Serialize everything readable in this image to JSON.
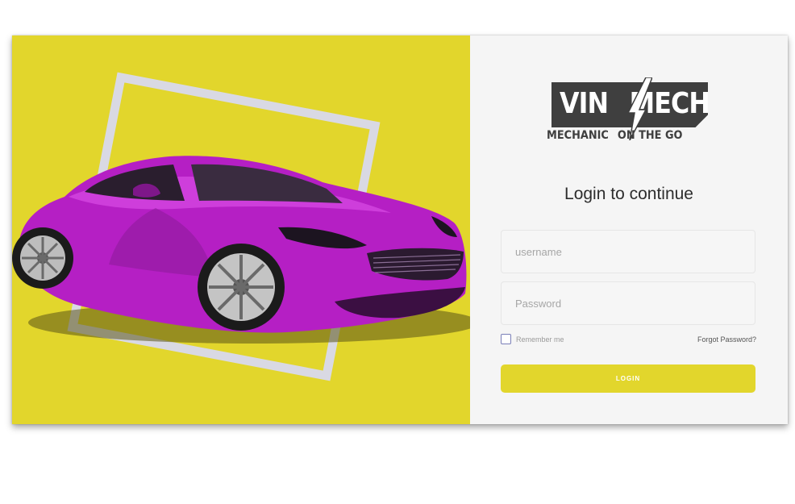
{
  "brand": {
    "name_left": "VIN",
    "name_right": "MECH",
    "tagline_left": "MECHANIC",
    "tagline_right": "ON THE GO"
  },
  "hero": {
    "background_color": "#e2d62c",
    "car_color": "#b51fc4",
    "frame_color": "#d9d9e3"
  },
  "login": {
    "heading": "Login to continue",
    "username_placeholder": "username",
    "password_placeholder": "Password",
    "remember_label": "Remember me",
    "remember_checked": false,
    "forgot_label": "Forgot Password?",
    "submit_label": "LOGIN",
    "accent_color": "#e2d62c"
  }
}
